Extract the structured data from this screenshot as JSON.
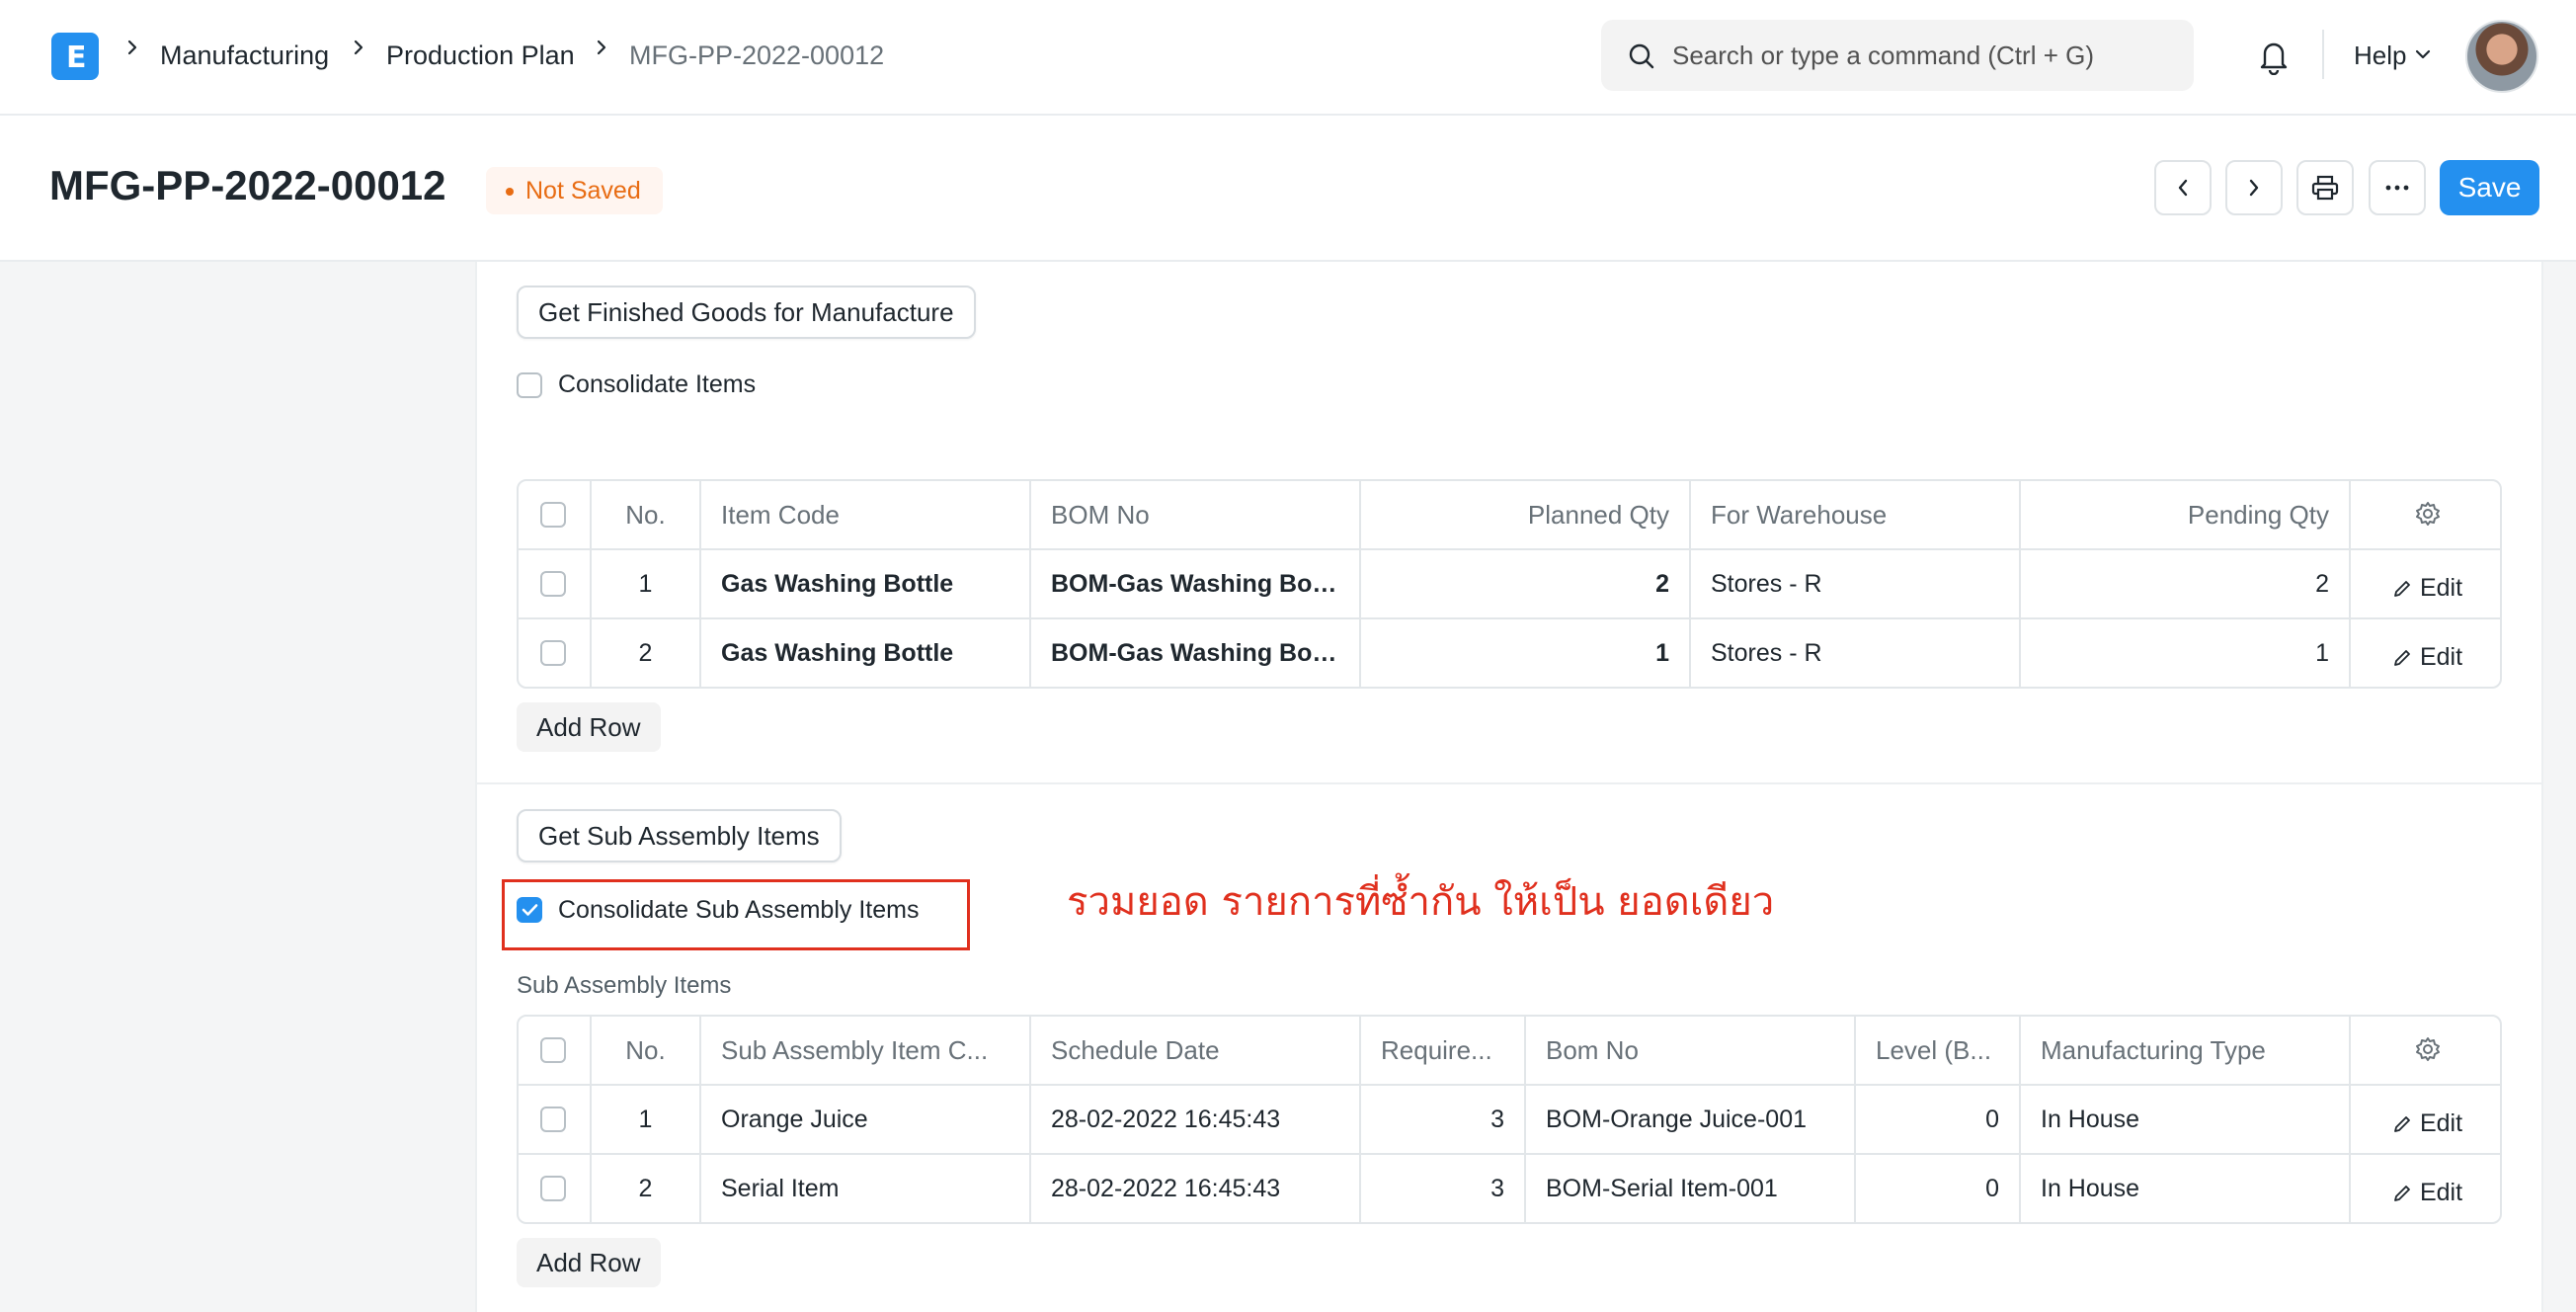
{
  "breadcrumbs": [
    "Manufacturing",
    "Production Plan",
    "MFG-PP-2022-00012"
  ],
  "search": {
    "placeholder": "Search or type a command (Ctrl + G)"
  },
  "navbar": {
    "help_label": "Help"
  },
  "header": {
    "title": "MFG-PP-2022-00012",
    "status": "Not Saved",
    "save_label": "Save"
  },
  "finished_goods": {
    "get_button": "Get Finished Goods for Manufacture",
    "consolidate_label": "Consolidate Items",
    "consolidate_checked": false,
    "columns": [
      "No.",
      "Item Code",
      "BOM No",
      "Planned Qty",
      "For Warehouse",
      "Pending Qty"
    ],
    "rows": [
      {
        "no": "1",
        "item_code": "Gas Washing Bottle",
        "bom_no": "BOM-Gas Washing Bot...",
        "planned_qty": "2",
        "warehouse": "Stores - R",
        "pending_qty": "2"
      },
      {
        "no": "2",
        "item_code": "Gas Washing Bottle",
        "bom_no": "BOM-Gas Washing Bot...",
        "planned_qty": "1",
        "warehouse": "Stores - R",
        "pending_qty": "1"
      }
    ],
    "edit_label": "Edit",
    "add_row_label": "Add Row"
  },
  "sub_assembly": {
    "get_button": "Get Sub Assembly Items",
    "consolidate_label": "Consolidate Sub Assembly Items",
    "consolidate_checked": true,
    "annotation": "รวมยอด รายการที่ซ้ำกัน ให้เป็น ยอดเดียว",
    "section_label": "Sub Assembly Items",
    "columns": [
      "No.",
      "Sub Assembly Item C...",
      "Schedule Date",
      "Require...",
      "Bom No",
      "Level (B...",
      "Manufacturing Type"
    ],
    "rows": [
      {
        "no": "1",
        "item": "Orange Juice",
        "schedule_date": "28-02-2022 16:45:43",
        "required": "3",
        "bom_no": "BOM-Orange Juice-001",
        "level": "0",
        "type": "In House"
      },
      {
        "no": "2",
        "item": "Serial Item",
        "schedule_date": "28-02-2022 16:45:43",
        "required": "3",
        "bom_no": "BOM-Serial Item-001",
        "level": "0",
        "type": "In House"
      }
    ],
    "edit_label": "Edit",
    "add_row_label": "Add Row"
  },
  "colors": {
    "accent": "#2490ef",
    "status": "#e86c13",
    "annotation": "#e0301e"
  }
}
